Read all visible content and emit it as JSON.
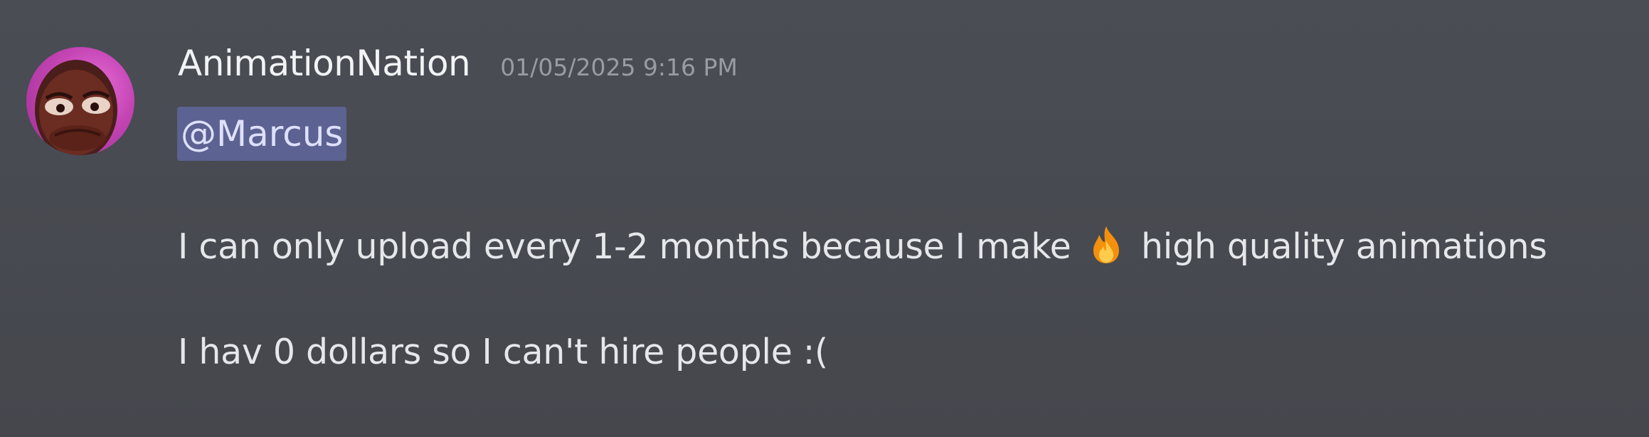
{
  "message": {
    "author": "AnimationNation",
    "timestamp": "01/05/2025 9:16 PM",
    "mention": "@Marcus",
    "line1_before_emoji": "I can only upload every 1-2 months because I make",
    "line1_emoji": "fire-icon",
    "line1_after_emoji": "high quality animations",
    "line2": "I hav 0 dollars so I can't hire people :("
  },
  "colors": {
    "background": "#4a4d54",
    "username": "#f2f3f5",
    "timestamp": "#9a9ca3",
    "mention_bg": "#5c6291",
    "mention_text": "#dee0fc",
    "body_text": "#e6e7ea"
  }
}
